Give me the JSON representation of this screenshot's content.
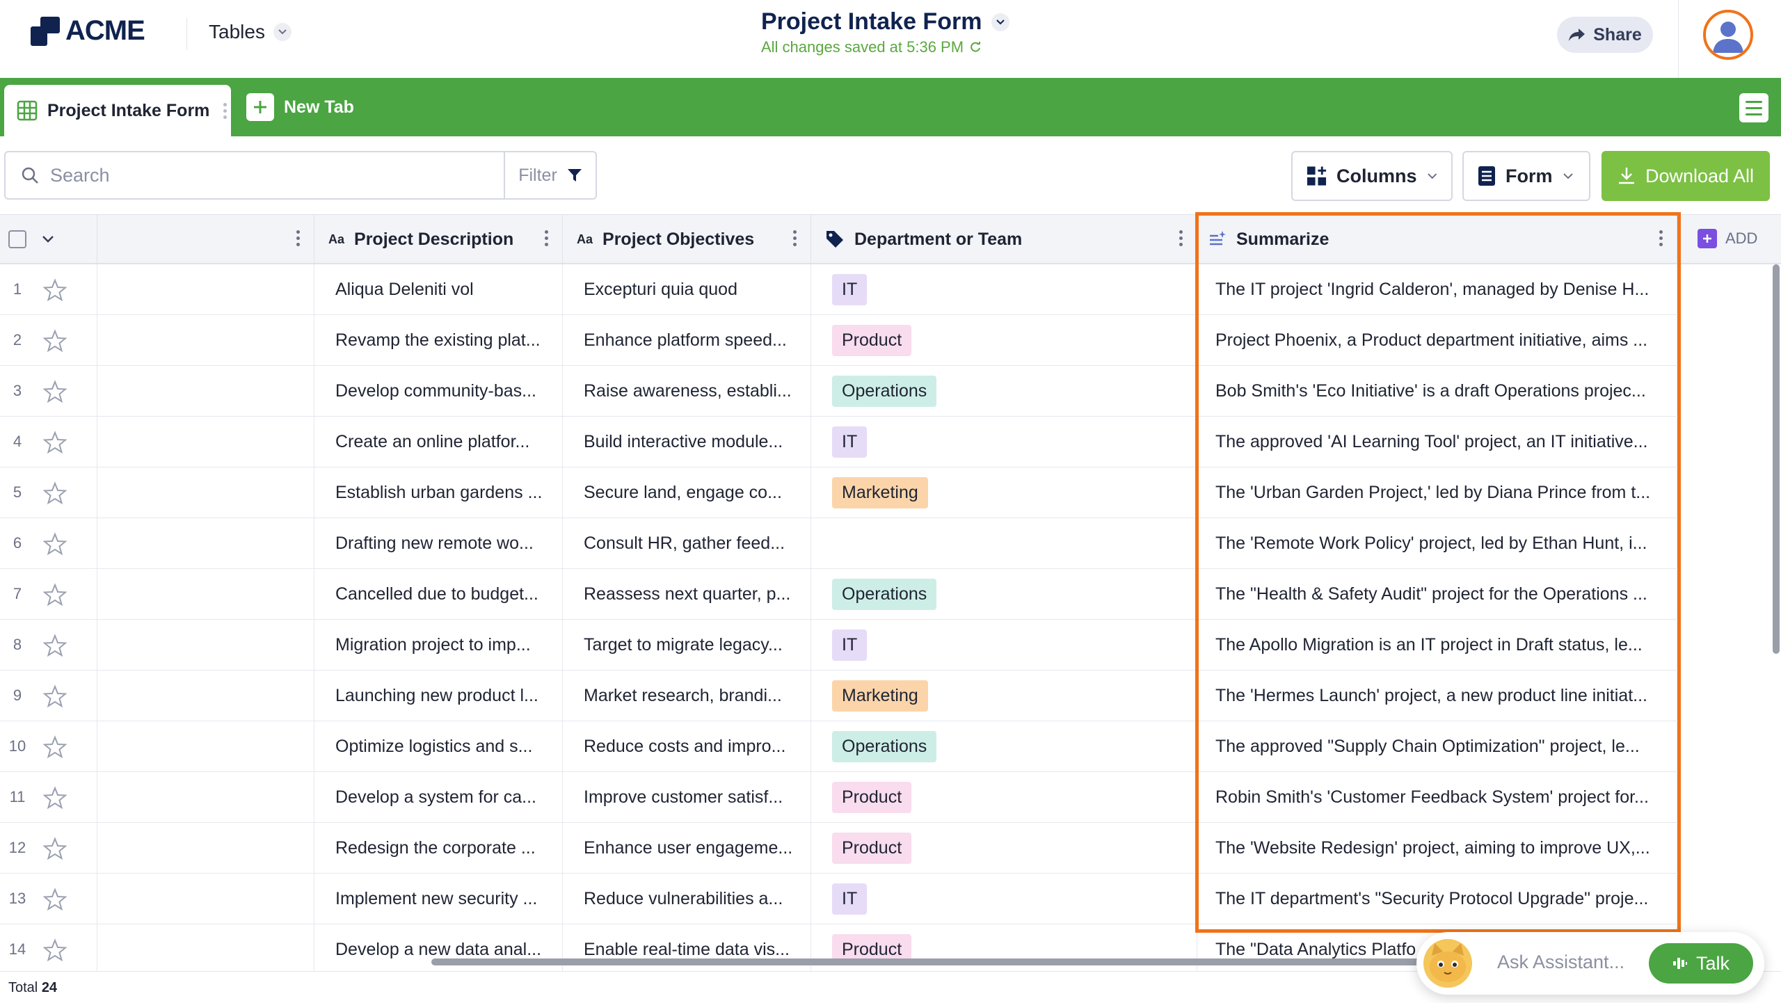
{
  "app": {
    "logo_text": "ACME",
    "section_menu": "Tables",
    "doc_title": "Project Intake Form",
    "saved_status": "All changes saved at 5:36 PM",
    "share_label": "Share"
  },
  "tabs": {
    "active_tab": "Project Intake Form",
    "new_tab": "New Tab"
  },
  "toolbar": {
    "search_placeholder": "Search",
    "filter_label": "Filter",
    "columns_label": "Columns",
    "form_label": "Form",
    "download_label": "Download All"
  },
  "columns": {
    "description": "Project Description",
    "objectives": "Project Objectives",
    "department": "Department or Team",
    "summarize": "Summarize",
    "add_label": "ADD"
  },
  "tag_colors": {
    "IT": "#e6dcf7",
    "Product": "#f9dcee",
    "Operations": "#cdeee6",
    "Marketing": "#fbd5a9"
  },
  "rows": [
    {
      "num": "1",
      "description": "Aliqua Deleniti vol",
      "objectives": "Excepturi quia quod",
      "department": "IT",
      "summary": "The IT project 'Ingrid Calderon', managed by Denise H..."
    },
    {
      "num": "2",
      "description": "Revamp the existing plat...",
      "objectives": "Enhance platform speed...",
      "department": "Product",
      "summary": "Project Phoenix, a Product department initiative, aims ..."
    },
    {
      "num": "3",
      "description": "Develop community-bas...",
      "objectives": "Raise awareness, establi...",
      "department": "Operations",
      "summary": "Bob Smith's 'Eco Initiative' is a draft Operations projec..."
    },
    {
      "num": "4",
      "description": "Create an online platfor...",
      "objectives": "Build interactive module...",
      "department": "IT",
      "summary": "The approved 'AI Learning Tool' project, an IT initiative..."
    },
    {
      "num": "5",
      "description": "Establish urban gardens ...",
      "objectives": "Secure land, engage co...",
      "department": "Marketing",
      "summary": "The 'Urban Garden Project,' led by Diana Prince from t..."
    },
    {
      "num": "6",
      "description": "Drafting new remote wo...",
      "objectives": "Consult HR, gather feed...",
      "department": "",
      "summary": "The 'Remote Work Policy' project, led by Ethan Hunt, i..."
    },
    {
      "num": "7",
      "description": "Cancelled due to budget...",
      "objectives": "Reassess next quarter, p...",
      "department": "Operations",
      "summary": "The \"Health & Safety Audit\" project for the Operations ..."
    },
    {
      "num": "8",
      "description": "Migration project to imp...",
      "objectives": "Target to migrate legacy...",
      "department": "IT",
      "summary": "The Apollo Migration is an IT project in Draft status, le..."
    },
    {
      "num": "9",
      "description": "Launching new product l...",
      "objectives": "Market research, brandi...",
      "department": "Marketing",
      "summary": "The 'Hermes Launch' project, a new product line initiat..."
    },
    {
      "num": "10",
      "description": "Optimize logistics and s...",
      "objectives": "Reduce costs and impro...",
      "department": "Operations",
      "summary": "The approved \"Supply Chain Optimization\" project, le..."
    },
    {
      "num": "11",
      "description": "Develop a system for ca...",
      "objectives": "Improve customer satisf...",
      "department": "Product",
      "summary": "Robin Smith's 'Customer Feedback System' project for..."
    },
    {
      "num": "12",
      "description": "Redesign the corporate ...",
      "objectives": "Enhance user engageme...",
      "department": "Product",
      "summary": "The 'Website Redesign' project, aiming to improve UX,..."
    },
    {
      "num": "13",
      "description": "Implement new security ...",
      "objectives": "Reduce vulnerabilities a...",
      "department": "IT",
      "summary": "The IT department's \"Security Protocol Upgrade\" proje..."
    },
    {
      "num": "14",
      "description": "Develop a new data anal...",
      "objectives": "Enable real-time data vis...",
      "department": "Product",
      "summary": "The \"Data Analytics Platfo"
    }
  ],
  "footer": {
    "total_label": "Total",
    "total_count": "24"
  },
  "assistant": {
    "placeholder": "Ask Assistant...",
    "talk_label": "Talk"
  }
}
